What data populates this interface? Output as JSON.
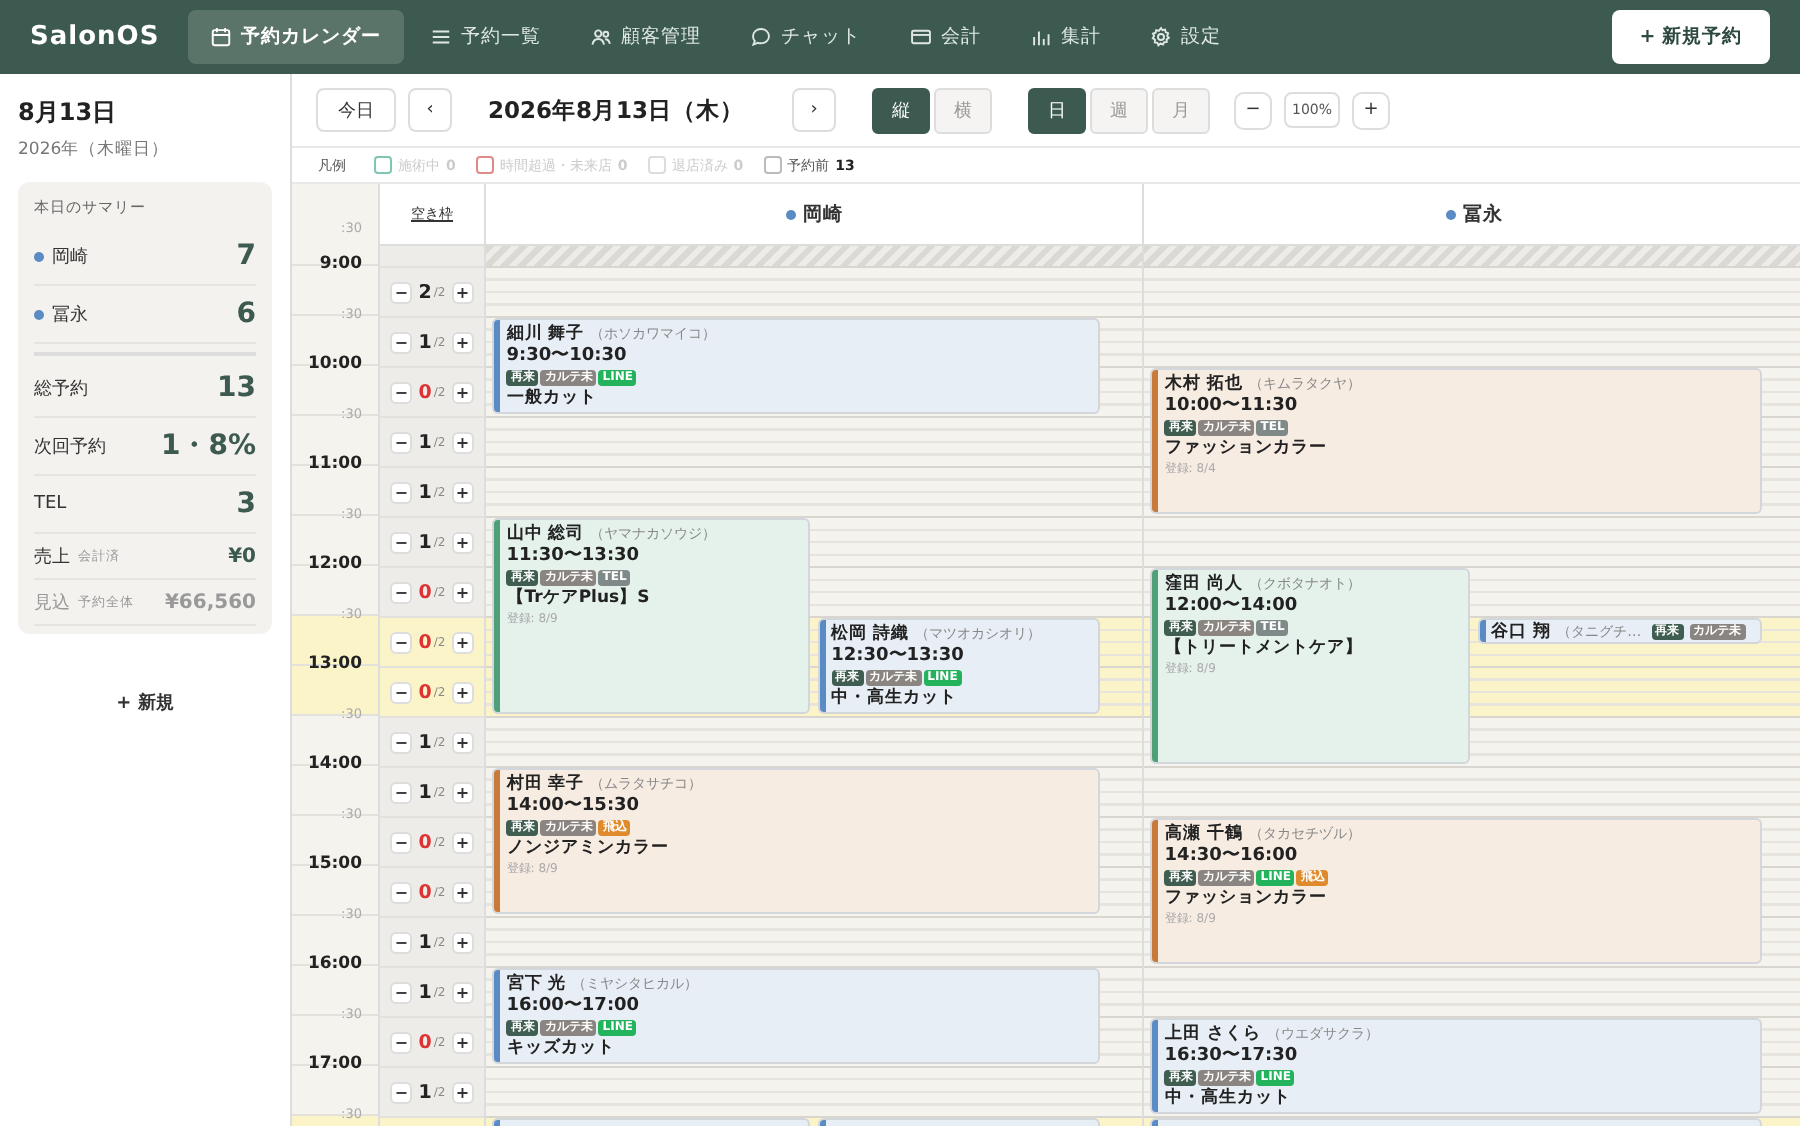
{
  "app": {
    "logo": "SalonOS",
    "nav": [
      {
        "label": "予約カレンダー",
        "selected": true
      },
      {
        "label": "予約一覧",
        "selected": false
      },
      {
        "label": "顧客管理",
        "selected": false
      },
      {
        "label": "チャット",
        "selected": false
      },
      {
        "label": "会計",
        "selected": false
      },
      {
        "label": "集計",
        "selected": false
      },
      {
        "label": "設定",
        "selected": false
      }
    ],
    "new_button": "+ 新規予約"
  },
  "sidebar": {
    "date": "8月13日",
    "subdate": "2026年（木曜日）",
    "summary": {
      "title": "本日のサマリー",
      "staff": [
        {
          "name": "岡崎",
          "count": "7",
          "color": "#5b8bc4"
        },
        {
          "name": "冨永",
          "count": "6",
          "color": "#5b8bc4"
        }
      ],
      "stats": [
        {
          "label": "総予約",
          "value": "13"
        },
        {
          "label": "次回予約",
          "value": "1・8%"
        },
        {
          "label": "TEL",
          "value": "3"
        }
      ],
      "money": [
        {
          "label": "売上",
          "sub": "会計済",
          "value": "¥0",
          "muted": false
        },
        {
          "label": "見込",
          "sub": "予約全体",
          "value": "¥66,560",
          "muted": true
        }
      ]
    },
    "new_link": "+ 新規"
  },
  "toolbar": {
    "today": "今日",
    "prev": "‹",
    "date": "2026年8月13日（木）",
    "next": "›",
    "orientation": [
      {
        "label": "縦",
        "selected": true
      },
      {
        "label": "横",
        "selected": false
      }
    ],
    "range": [
      {
        "label": "日",
        "selected": true
      },
      {
        "label": "週",
        "selected": false
      },
      {
        "label": "月",
        "selected": false
      }
    ],
    "zoom_out": "−",
    "zoom": "100%",
    "zoom_in": "+"
  },
  "legend": {
    "title": "凡例",
    "items": [
      {
        "label": "施術中",
        "count": "0",
        "color": "#7fc6b5",
        "active": false
      },
      {
        "label": "時間超過・未来店",
        "count": "0",
        "color": "#e08a8a",
        "active": false
      },
      {
        "label": "退店済み",
        "count": "0",
        "color": "#dddddd",
        "active": false
      },
      {
        "label": "予約前",
        "count": "13",
        "color": "#bbbbbb",
        "active": true
      }
    ]
  },
  "calendar": {
    "top_label": ":30",
    "vacancy_title": "空き枠",
    "slots": [
      {
        "time": "9:00",
        "minus": "−",
        "count": "2",
        "capacity": "/2",
        "plus": "+",
        "full": false,
        "highlighted": false
      },
      {
        "time": ":30",
        "minus": "−",
        "count": "1",
        "capacity": "/2",
        "plus": "+",
        "full": false,
        "highlighted": false
      },
      {
        "time": "10:00",
        "minus": "−",
        "count": "0",
        "capacity": "/2",
        "plus": "+",
        "full": true,
        "highlighted": false
      },
      {
        "time": ":30",
        "minus": "−",
        "count": "1",
        "capacity": "/2",
        "plus": "+",
        "full": false,
        "highlighted": false
      },
      {
        "time": "11:00",
        "minus": "−",
        "count": "1",
        "capacity": "/2",
        "plus": "+",
        "full": false,
        "highlighted": false
      },
      {
        "time": ":30",
        "minus": "−",
        "count": "1",
        "capacity": "/2",
        "plus": "+",
        "full": false,
        "highlighted": false
      },
      {
        "time": "12:00",
        "minus": "−",
        "count": "0",
        "capacity": "/2",
        "plus": "+",
        "full": true,
        "highlighted": false
      },
      {
        "time": ":30",
        "minus": "−",
        "count": "0",
        "capacity": "/2",
        "plus": "+",
        "full": true,
        "highlighted": true
      },
      {
        "time": "13:00",
        "minus": "−",
        "count": "0",
        "capacity": "/2",
        "plus": "+",
        "full": true,
        "highlighted": true
      },
      {
        "time": ":30",
        "minus": "−",
        "count": "1",
        "capacity": "/2",
        "plus": "+",
        "full": false,
        "highlighted": false
      },
      {
        "time": "14:00",
        "minus": "−",
        "count": "1",
        "capacity": "/2",
        "plus": "+",
        "full": false,
        "highlighted": false
      },
      {
        "time": ":30",
        "minus": "−",
        "count": "0",
        "capacity": "/2",
        "plus": "+",
        "full": true,
        "highlighted": false
      },
      {
        "time": "15:00",
        "minus": "−",
        "count": "0",
        "capacity": "/2",
        "plus": "+",
        "full": true,
        "highlighted": false
      },
      {
        "time": ":30",
        "minus": "−",
        "count": "1",
        "capacity": "/2",
        "plus": "+",
        "full": false,
        "highlighted": false
      },
      {
        "time": "16:00",
        "minus": "−",
        "count": "1",
        "capacity": "/2",
        "plus": "+",
        "full": false,
        "highlighted": false
      },
      {
        "time": ":30",
        "minus": "−",
        "count": "0",
        "capacity": "/2",
        "plus": "+",
        "full": true,
        "highlighted": false
      },
      {
        "time": "17:00",
        "minus": "−",
        "count": "1",
        "capacity": "/2",
        "plus": "+",
        "full": false,
        "highlighted": false
      },
      {
        "time": ":30",
        "highlighted": true
      }
    ],
    "staff": [
      {
        "name": "岡崎",
        "color": "#5b8bc4",
        "appointments": [
          {
            "kind": "card",
            "color": "#5b8bc4",
            "name": "細川 舞子",
            "kana": "（ホソカワマイコ）",
            "time": "9:30〜10:30",
            "tags": [
              {
                "text": "再来",
                "color": "#3f5d50"
              },
              {
                "text": "カルテ未",
                "color": "#8a8580"
              },
              {
                "text": "LINE",
                "color": "#22b35c"
              }
            ],
            "menu": "一般カット"
          },
          {
            "kind": "card",
            "color": "#4f9f78",
            "name": "山中 総司",
            "kana": "（ヤマナカソウジ）",
            "time": "11:30〜13:30",
            "tags": [
              {
                "text": "再来",
                "color": "#3f5d50"
              },
              {
                "text": "カルテ未",
                "color": "#8a8580"
              },
              {
                "text": "TEL",
                "color": "#7f8a88"
              }
            ],
            "menu": "【TrケアPlus】S",
            "note": "登録: 8/9"
          },
          {
            "kind": "card",
            "color": "#5b8bc4",
            "name": "松岡 詩織",
            "kana": "（マツオカシオリ）",
            "time": "12:30〜13:30",
            "tags": [
              {
                "text": "再来",
                "color": "#3f5d50"
              },
              {
                "text": "カルテ未",
                "color": "#8a8580"
              },
              {
                "text": "LINE",
                "color": "#22b35c"
              }
            ],
            "menu": "中・高生カット"
          },
          {
            "kind": "card",
            "color": "#c87a3a",
            "name": "村田 幸子",
            "kana": "（ムラタサチコ）",
            "time": "14:00〜15:30",
            "tags": [
              {
                "text": "再来",
                "color": "#3f5d50"
              },
              {
                "text": "カルテ未",
                "color": "#8a8580"
              },
              {
                "text": "飛込",
                "color": "#e08a2e"
              }
            ],
            "menu": "ノンジアミンカラー",
            "note": "登録: 8/9"
          },
          {
            "kind": "card",
            "color": "#5b8bc4",
            "name": "宮下 光",
            "kana": "（ミヤシタヒカル）",
            "time": "16:00〜17:00",
            "tags": [
              {
                "text": "再来",
                "color": "#3f5d50"
              },
              {
                "text": "カルテ未",
                "color": "#8a8580"
              },
              {
                "text": "LINE",
                "color": "#22b35c"
              }
            ],
            "menu": "キッズカット"
          },
          {
            "kind": "clipped",
            "color": "#5b8bc4"
          },
          {
            "kind": "clipped",
            "color": "#5b8bc4"
          }
        ]
      },
      {
        "name": "冨永",
        "color": "#5b8bc4",
        "appointments": [
          {
            "kind": "card",
            "color": "#c87a3a",
            "name": "木村 拓也",
            "kana": "（キムラタクヤ）",
            "time": "10:00〜11:30",
            "tags": [
              {
                "text": "再来",
                "color": "#3f5d50"
              },
              {
                "text": "カルテ未",
                "color": "#8a8580"
              },
              {
                "text": "TEL",
                "color": "#7f8a88"
              }
            ],
            "menu": "ファッションカラー",
            "note": "登録: 8/4"
          },
          {
            "kind": "card",
            "color": "#4f9f78",
            "name": "窪田 尚人",
            "kana": "（クボタナオト）",
            "time": "12:00〜14:00",
            "tags": [
              {
                "text": "再来",
                "color": "#3f5d50"
              },
              {
                "text": "カルテ未",
                "color": "#8a8580"
              },
              {
                "text": "TEL",
                "color": "#7f8a88"
              }
            ],
            "menu": "【トリートメントケア】",
            "note": "登録: 8/9"
          },
          {
            "kind": "compact",
            "color": "#5b8bc4",
            "name": "谷口 翔",
            "kana": "（タニグチ…",
            "tags": [
              {
                "text": "再来",
                "color": "#3f5d50"
              },
              {
                "text": "カルテ未",
                "color": "#8a8580"
              }
            ]
          },
          {
            "kind": "card",
            "color": "#c87a3a",
            "name": "高瀬 千鶴",
            "kana": "（タカセチヅル）",
            "time": "14:30〜16:00",
            "tags": [
              {
                "text": "再来",
                "color": "#3f5d50"
              },
              {
                "text": "カルテ未",
                "color": "#8a8580"
              },
              {
                "text": "LINE",
                "color": "#22b35c"
              },
              {
                "text": "飛込",
                "color": "#e08a2e"
              }
            ],
            "menu": "ファッションカラー",
            "note": "登録: 8/9"
          },
          {
            "kind": "card",
            "color": "#5b8bc4",
            "name": "上田 さくら",
            "kana": "（ウエダサクラ）",
            "time": "16:30〜17:30",
            "tags": [
              {
                "text": "再来",
                "color": "#3f5d50"
              },
              {
                "text": "カルテ未",
                "color": "#8a8580"
              },
              {
                "text": "LINE",
                "color": "#22b35c"
              }
            ],
            "menu": "中・高生カット"
          },
          {
            "kind": "clipped",
            "color": "#5b8bc4"
          }
        ]
      }
    ]
  }
}
